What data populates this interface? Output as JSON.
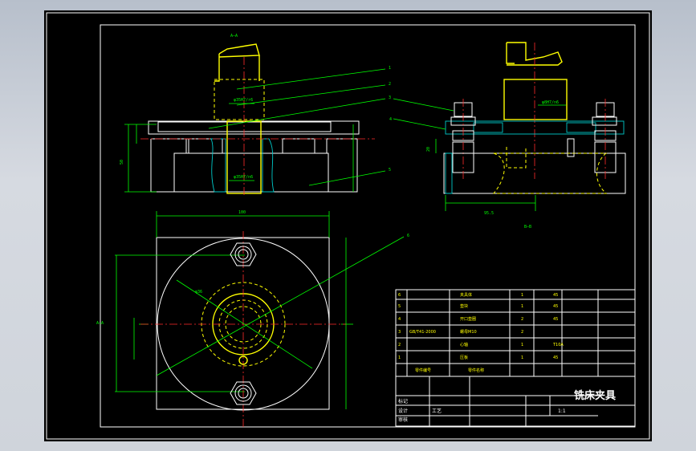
{
  "title_block": {
    "drawing_title": "铣床夹具",
    "scale": "1:1"
  },
  "section_label": "A—A",
  "view_label": "B—B",
  "dims": {
    "top_width": "100",
    "height_left": "50",
    "base_dim": "95.5",
    "fit_upper": "φ35H7/r6",
    "fit_lower": "φ35H7/n6",
    "fit_right": "φ8H7/n6",
    "phi": "φ36",
    "h_right": "20"
  },
  "callouts": [
    "1",
    "2",
    "3",
    "4",
    "5",
    "6"
  ],
  "bom": [
    {
      "no": "6",
      "code": "",
      "name": "夹具体",
      "qty": "1",
      "material": "45"
    },
    {
      "no": "5",
      "code": "",
      "name": "垫块",
      "qty": "1",
      "material": "45"
    },
    {
      "no": "4",
      "code": "",
      "name": "开口垫圈",
      "qty": "2",
      "material": "45"
    },
    {
      "no": "3",
      "code": "GB/T41-2000",
      "name": "螺母M10",
      "qty": "2",
      "material": ""
    },
    {
      "no": "2",
      "code": "",
      "name": "心轴",
      "qty": "1",
      "material": "T10A"
    },
    {
      "no": "1",
      "code": "",
      "name": "压板",
      "qty": "1",
      "material": "45"
    }
  ],
  "bom_header": {
    "code": "零件编号",
    "name": "零件名称"
  },
  "labels_rows": [
    "标记",
    "设计",
    "审核",
    "工艺"
  ]
}
